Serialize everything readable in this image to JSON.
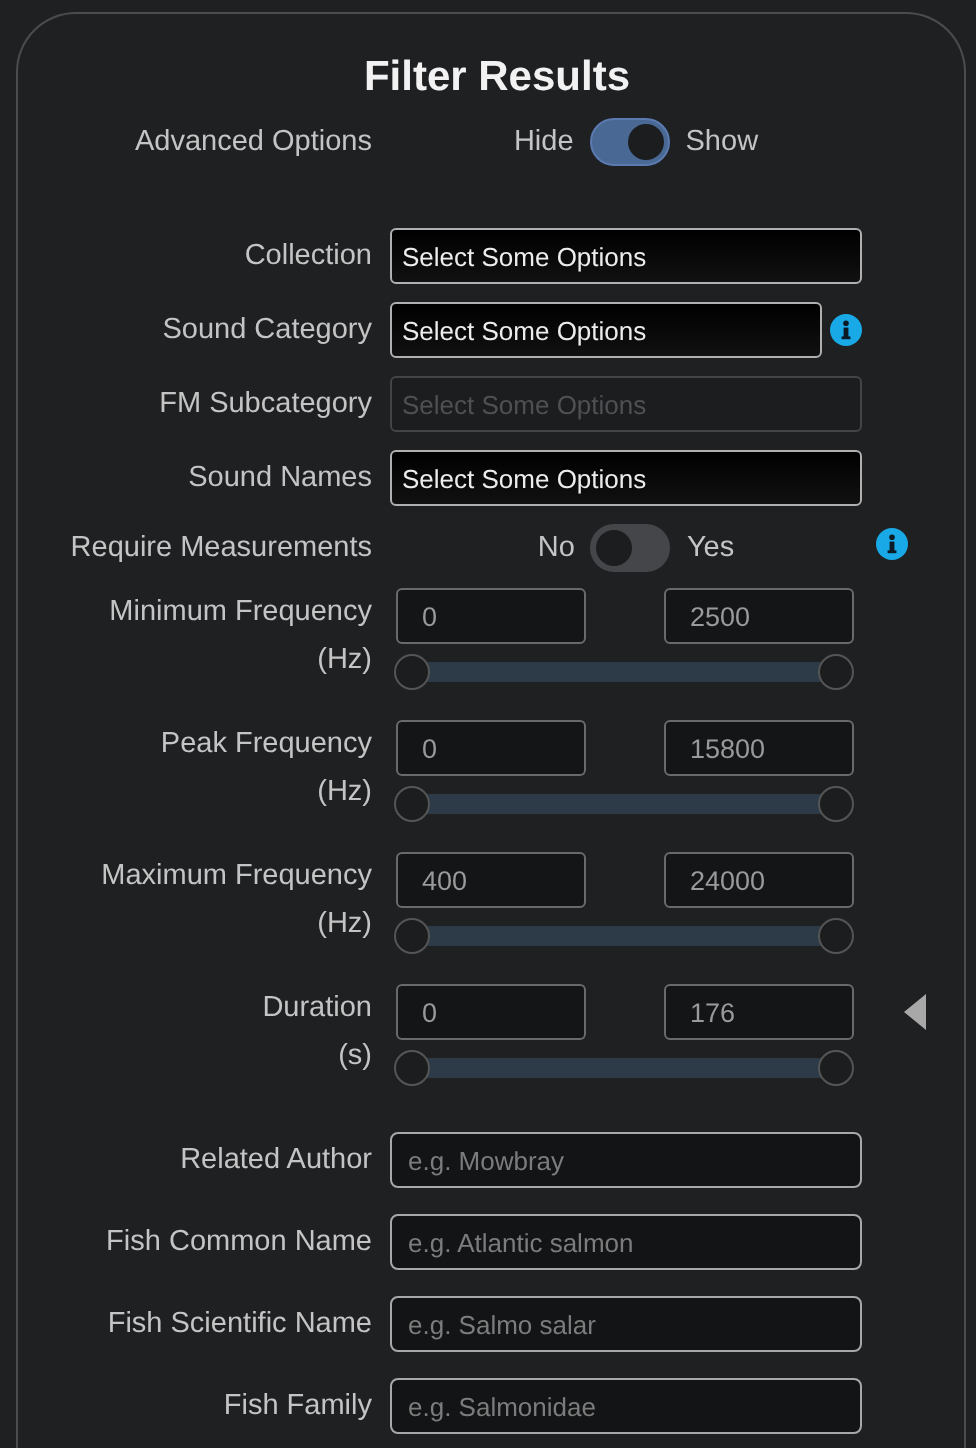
{
  "title": "Filter Results",
  "rows": [
    {
      "kind": "toggle",
      "label": "Advanced Options",
      "off_label": "Hide",
      "on_label": "Show",
      "on": true,
      "info": false
    },
    {
      "kind": "select",
      "label": "Collection",
      "placeholder": "Select Some Options",
      "disabled": false,
      "info": false
    },
    {
      "kind": "select",
      "label": "Sound Category",
      "placeholder": "Select Some Options",
      "disabled": false,
      "info": true
    },
    {
      "kind": "select",
      "label": "FM Subcategory",
      "placeholder": "Select Some Options",
      "disabled": true,
      "info": false
    },
    {
      "kind": "select",
      "label": "Sound Names",
      "placeholder": "Select Some Options",
      "disabled": false,
      "info": false
    },
    {
      "kind": "toggle",
      "label": "Require Measurements",
      "off_label": "No",
      "on_label": "Yes",
      "on": false,
      "info": true
    },
    {
      "kind": "range",
      "label": "Minimum Frequency",
      "unit": "(Hz)",
      "min_value": "0",
      "max_value": "2500",
      "low": {
        "level": 0
      },
      "high": {
        "level": 1
      },
      "side_arrow": false
    },
    {
      "kind": "range",
      "label": "Peak Frequency",
      "unit": "(Hz)",
      "min_value": "0",
      "max_value": "15800",
      "low": {
        "level": 0
      },
      "high": {
        "level": 1
      },
      "side_arrow": false
    },
    {
      "kind": "range",
      "label": "Maximum Frequency",
      "unit": "(Hz)",
      "min_value": "400",
      "max_value": "24000",
      "low": {
        "level": 0
      },
      "high": {
        "level": 1
      },
      "side_arrow": false
    },
    {
      "kind": "range",
      "label": "Duration",
      "unit": "(s)",
      "min_value": "0",
      "max_value": "176",
      "low": {
        "level": 0
      },
      "high": {
        "level": 1
      },
      "side_arrow": true
    },
    {
      "kind": "text",
      "label": "Related Author",
      "placeholder": "e.g. Mowbray"
    },
    {
      "kind": "text",
      "label": "Fish Common Name",
      "placeholder": "e.g. Atlantic salmon"
    },
    {
      "kind": "text",
      "label": "Fish Scientific Name",
      "placeholder": "e.g. Salmo salar"
    },
    {
      "kind": "text",
      "label": "Fish Family",
      "placeholder": "e.g. Salmonidae"
    }
  ]
}
